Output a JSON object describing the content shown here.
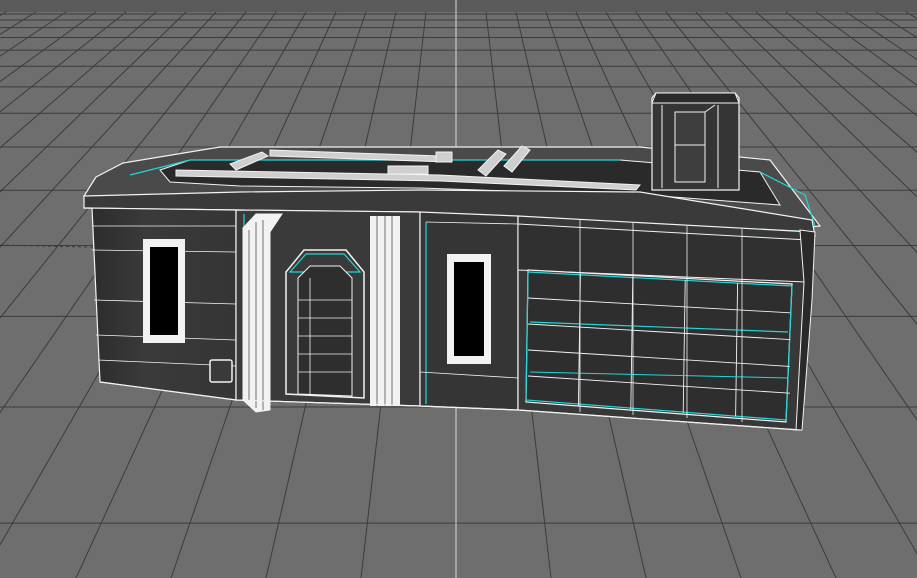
{
  "viewport": {
    "background": "#6e6e6e",
    "grid_color": "#3c3c3c",
    "horizon_color": "#8a8a8a",
    "axis_color": "#d8d8d8",
    "wire_color": "#f2f2f2",
    "selection_color": "#22d6d6",
    "wall_color": "#3a3a3a",
    "dark_wall_color": "#242424",
    "glass_color": "#000000"
  },
  "model": {
    "name": "",
    "selected": true
  }
}
